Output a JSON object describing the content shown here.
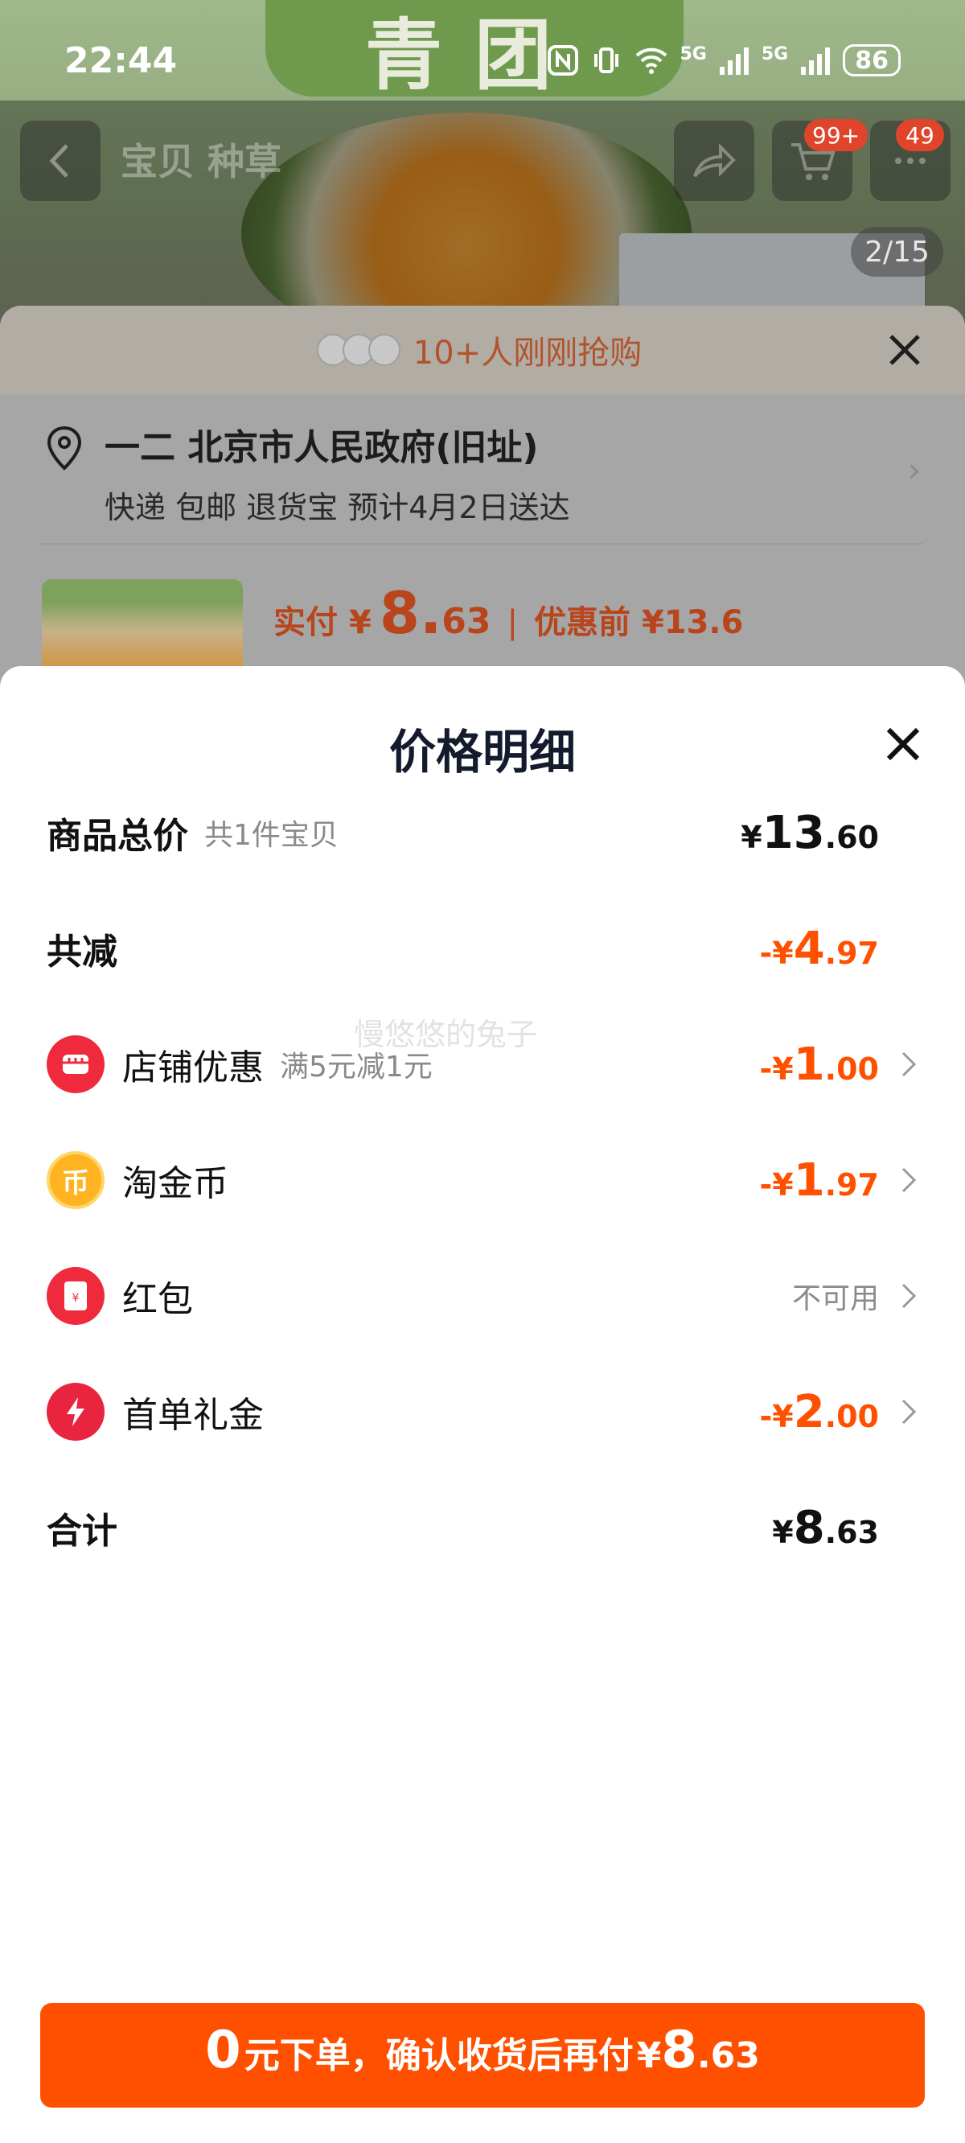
{
  "status_bar": {
    "time": "22:44",
    "network_1": "5G",
    "network_2": "5G",
    "battery": "86"
  },
  "background_page": {
    "brand_tag": "青团",
    "nav_tabs": "宝贝 种草",
    "cart_badge": "99+",
    "msg_badge": "49",
    "image_pager": "2/15"
  },
  "order_sheet": {
    "social_proof": "10+人刚刚抢购",
    "address_main": "一二 北京市人民政府(旧址)",
    "address_sub": "快递 包邮 退货宝 预计4月2日送达",
    "price_label": "实付",
    "price_currency": "¥",
    "price_int": "8.",
    "price_dec": "63",
    "price_sep": "|",
    "price_before": "优惠前 ¥13.6"
  },
  "price_detail": {
    "title": "价格明细",
    "rows": [
      {
        "label": "商品总价",
        "sub": "共1件宝贝",
        "currency": "¥",
        "int": "13",
        "dec": ".60"
      },
      {
        "label": "共减",
        "currency": "-¥",
        "int": "4",
        "dec": ".97"
      },
      {
        "label": "店铺优惠",
        "sub": "满5元减1元",
        "currency": "-¥",
        "int": "1",
        "dec": ".00",
        "icon": "shop-icon"
      },
      {
        "label": "淘金币",
        "currency": "-¥",
        "int": "1",
        "dec": ".97",
        "icon": "coin-icon"
      },
      {
        "label": "红包",
        "status": "不可用",
        "icon": "red-packet-icon"
      },
      {
        "label": "首单礼金",
        "currency": "-¥",
        "int": "2",
        "dec": ".00",
        "icon": "lightning-icon"
      },
      {
        "label": "合计",
        "currency": "¥",
        "int": "8",
        "dec": ".63"
      }
    ],
    "watermark": "慢悠悠的兔子"
  },
  "cta": {
    "zero": "0",
    "text": "元下单，确认收货后再付",
    "currency": "¥",
    "int": "8",
    "dec": ".63"
  },
  "colors": {
    "accent": "#ff5000",
    "title": "#141b2d"
  }
}
